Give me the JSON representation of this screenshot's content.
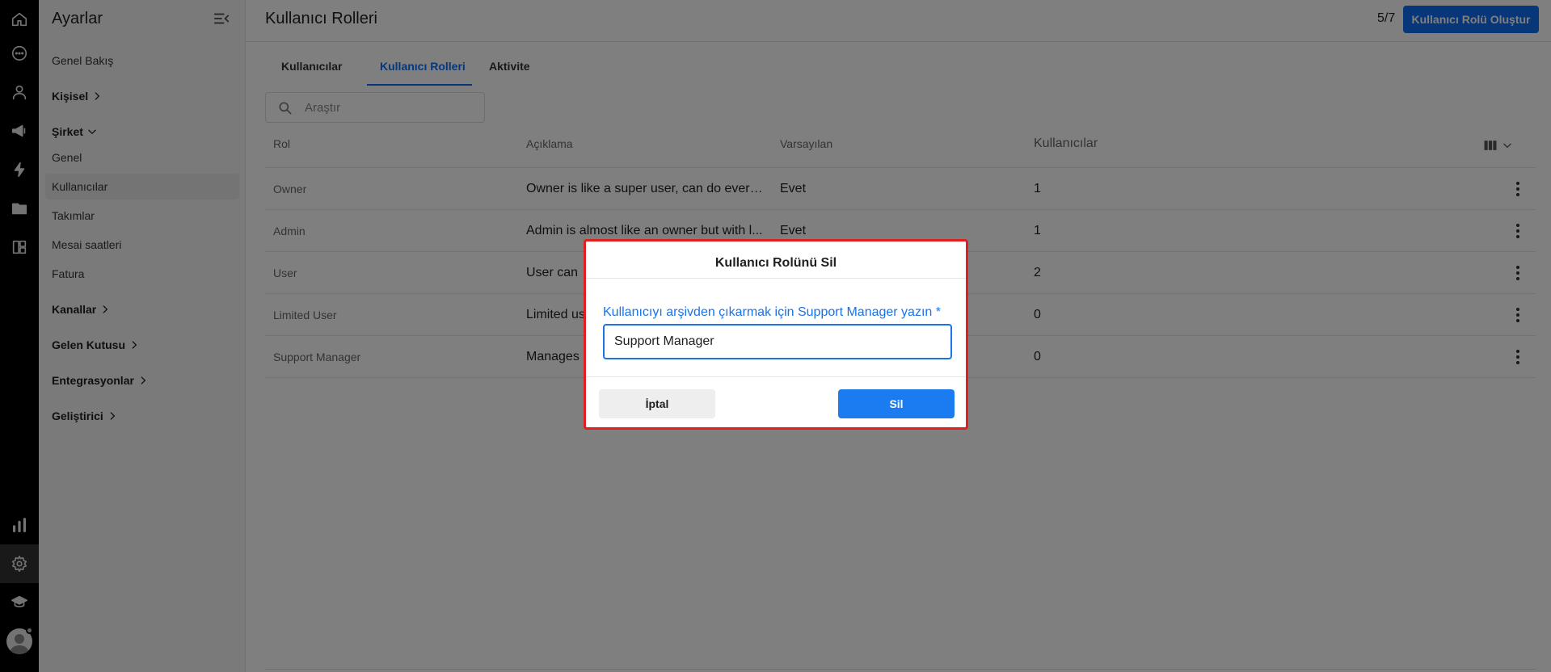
{
  "rail": {
    "icons": [
      "home-icon",
      "chat-icon",
      "contact-icon",
      "megaphone-icon",
      "bolt-icon",
      "folder-user-icon",
      "dashboard-icon",
      "bar-chart-icon",
      "settings-gear-icon",
      "graduation-cap-icon",
      "avatar-icon"
    ]
  },
  "sidebar": {
    "title": "Ayarlar",
    "overview": "Genel Bakış",
    "personal": "Kişisel",
    "company": "Şirket",
    "company_items": [
      "Genel",
      "Kullanıcılar",
      "Takımlar",
      "Mesai saatleri",
      "Fatura"
    ],
    "channels": "Kanallar",
    "inbox": "Gelen Kutusu",
    "integrations": "Entegrasyonlar",
    "developer": "Geliştirici"
  },
  "header": {
    "title": "Kullanıcı Rolleri",
    "counter": "5/7",
    "create_button": "Kullanıcı Rolü Oluştur"
  },
  "tabs": [
    "Kullanıcılar",
    "Kullanıcı Rolleri",
    "Aktivite"
  ],
  "search": {
    "placeholder": "Araştır"
  },
  "table": {
    "columns": [
      "Rol",
      "Açıklama",
      "Varsayılan",
      "Kullanıcılar"
    ],
    "rows": [
      {
        "role": "Owner",
        "description": "Owner is like a super user, can do everyt...",
        "default": "Evet",
        "users": "1"
      },
      {
        "role": "Admin",
        "description": "Admin is almost like an owner but with l...",
        "default": "Evet",
        "users": "1"
      },
      {
        "role": "User",
        "description": "User can",
        "default": "",
        "users": "2"
      },
      {
        "role": "Limited User",
        "description": "Limited us",
        "default": "",
        "users": "0"
      },
      {
        "role": "Support Manager",
        "description": "Manages",
        "default": "",
        "users": "0"
      }
    ]
  },
  "modal": {
    "title": "Kullanıcı Rolünü Sil",
    "label": "Kullanıcıyı arşivden çıkarmak için Support Manager yazın *",
    "input_value": "Support Manager",
    "cancel": "İptal",
    "delete": "Sil"
  },
  "colors": {
    "primary": "#0f6cf2",
    "modal_border": "#e0201e",
    "label_blue": "#1a73e8"
  }
}
